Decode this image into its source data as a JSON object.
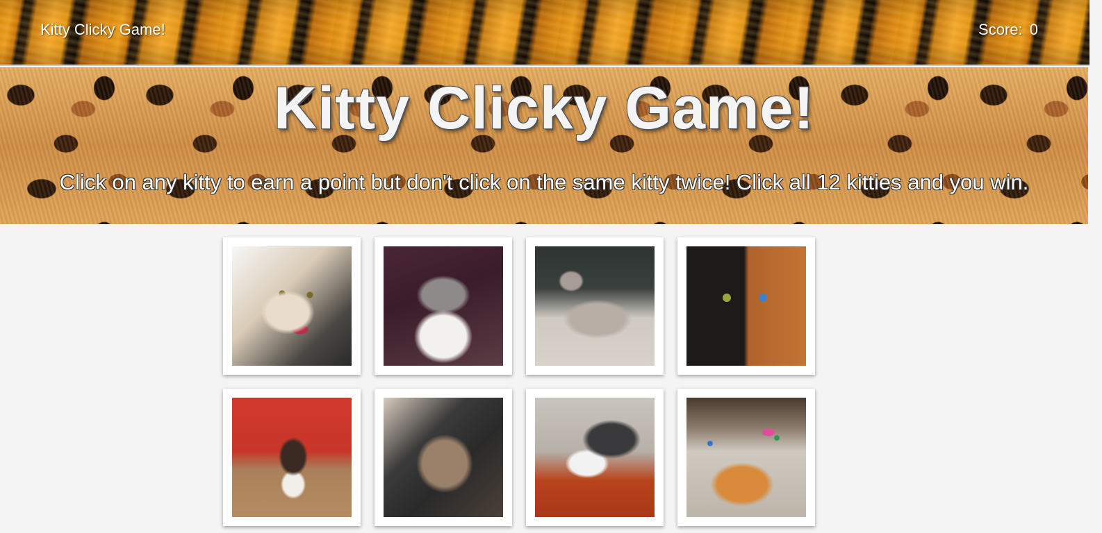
{
  "navbar": {
    "brand": "Kitty Clicky Game!",
    "score_label": "Score:",
    "score_value": "0"
  },
  "hero": {
    "title": "Kitty Clicky Game!",
    "subtitle": "Click on any kitty to earn a point but don't click on the same kitty twice! Click all 12 kitties and you win."
  },
  "cards": [
    {
      "name": "kitty-card-1"
    },
    {
      "name": "kitty-card-2"
    },
    {
      "name": "kitty-card-3"
    },
    {
      "name": "kitty-card-4"
    },
    {
      "name": "kitty-card-5"
    },
    {
      "name": "kitty-card-6"
    },
    {
      "name": "kitty-card-7"
    },
    {
      "name": "kitty-card-8"
    }
  ],
  "colors": {
    "page_background": "#f4f4f4",
    "card_background": "#ffffff",
    "text": "#ffffff"
  }
}
